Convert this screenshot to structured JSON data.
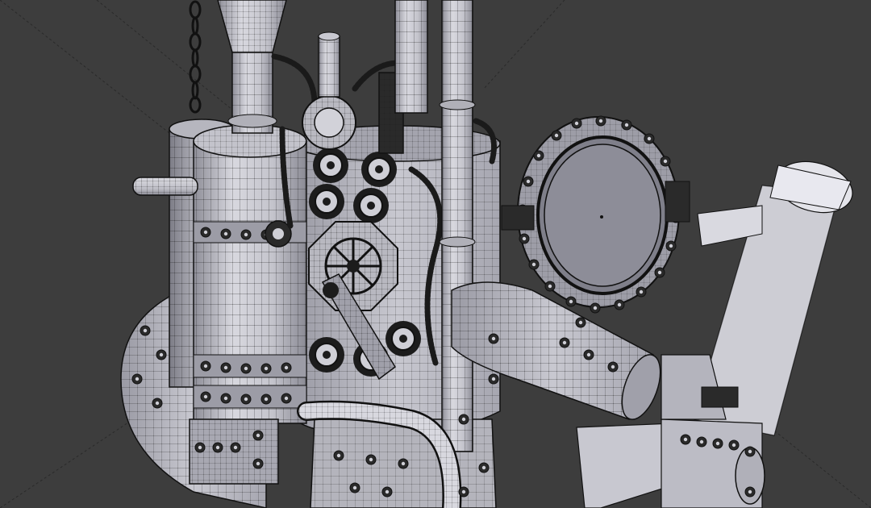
{
  "viewport": {
    "mode": "edit-mode-wireframe",
    "background_color": "#3d3d3d",
    "mesh_face_color": "#c9c9d0",
    "mesh_shadow_color": "#8e8e98",
    "wire_color": "#1a1a1a",
    "vertex_color": "#111111",
    "highlight_color": "#e8e8ef"
  }
}
